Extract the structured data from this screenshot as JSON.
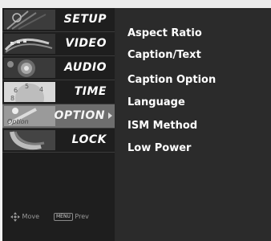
{
  "menu": {
    "items": [
      {
        "label": "SETUP",
        "icon": "setup-icon",
        "selected": false
      },
      {
        "label": "VIDEO",
        "icon": "video-icon",
        "selected": false
      },
      {
        "label": "AUDIO",
        "icon": "audio-icon",
        "selected": false
      },
      {
        "label": "TIME",
        "icon": "time-icon",
        "selected": false
      },
      {
        "label": "OPTION",
        "icon": "option-icon",
        "selected": true
      },
      {
        "label": "LOCK",
        "icon": "lock-icon",
        "selected": false
      }
    ]
  },
  "submenu": {
    "items": [
      {
        "label": "Aspect Ratio"
      },
      {
        "label": "Caption/Text"
      },
      {
        "label": "Caption Option"
      },
      {
        "label": "Language"
      },
      {
        "label": "ISM Method"
      },
      {
        "label": "Low Power"
      }
    ]
  },
  "footer": {
    "move_label": "Move",
    "prev_key": "MENU",
    "prev_label": "Prev"
  },
  "colors": {
    "panel_bg": "#2b2b2b",
    "selected_bg": "#6e6e6e",
    "text": "#ffffff"
  }
}
